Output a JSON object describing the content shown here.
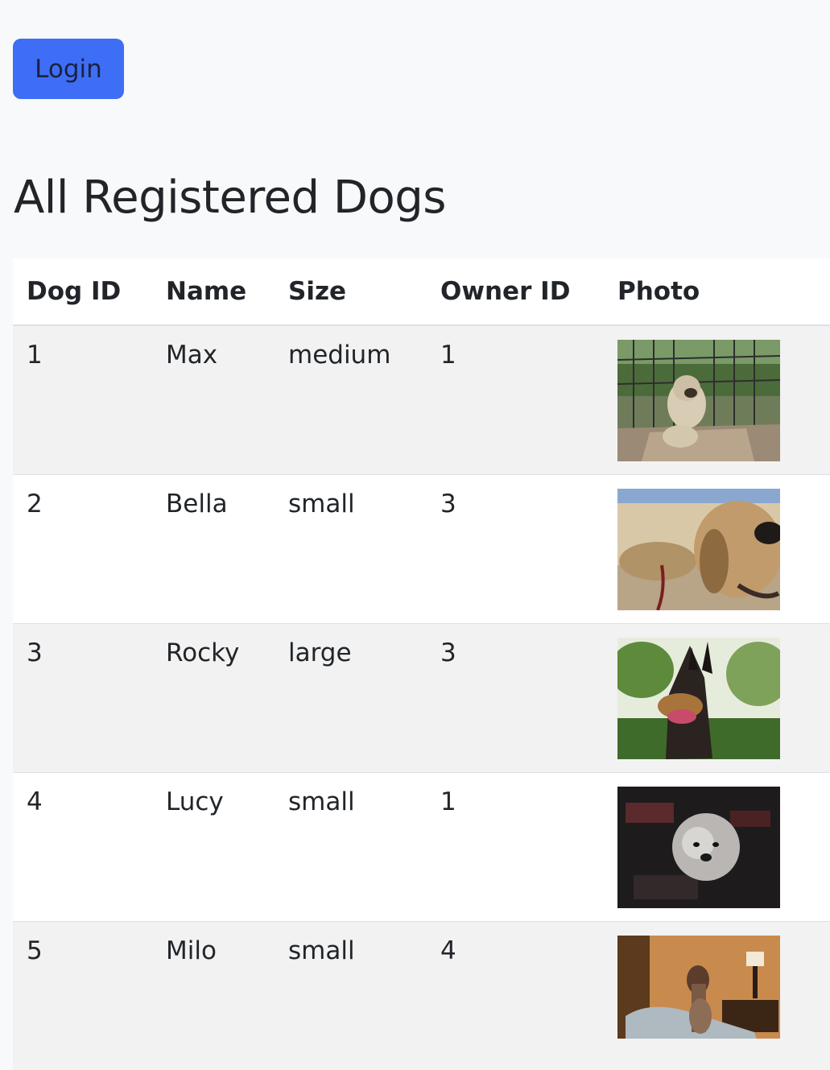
{
  "login_button": "Login",
  "page_title": "All Registered Dogs",
  "table": {
    "headers": [
      "Dog ID",
      "Name",
      "Size",
      "Owner ID",
      "Photo"
    ],
    "rows": [
      {
        "dog_id": "1",
        "name": "Max",
        "size": "medium",
        "owner_id": "1"
      },
      {
        "dog_id": "2",
        "name": "Bella",
        "size": "small",
        "owner_id": "3"
      },
      {
        "dog_id": "3",
        "name": "Rocky",
        "size": "large",
        "owner_id": "3"
      },
      {
        "dog_id": "4",
        "name": "Lucy",
        "size": "small",
        "owner_id": "1"
      },
      {
        "dog_id": "5",
        "name": "Milo",
        "size": "small",
        "owner_id": "4"
      }
    ]
  },
  "colors": {
    "login_button_bg": "#3d6ef5",
    "page_bg": "#f8f9fa",
    "striped_row": "#f2f2f2"
  }
}
